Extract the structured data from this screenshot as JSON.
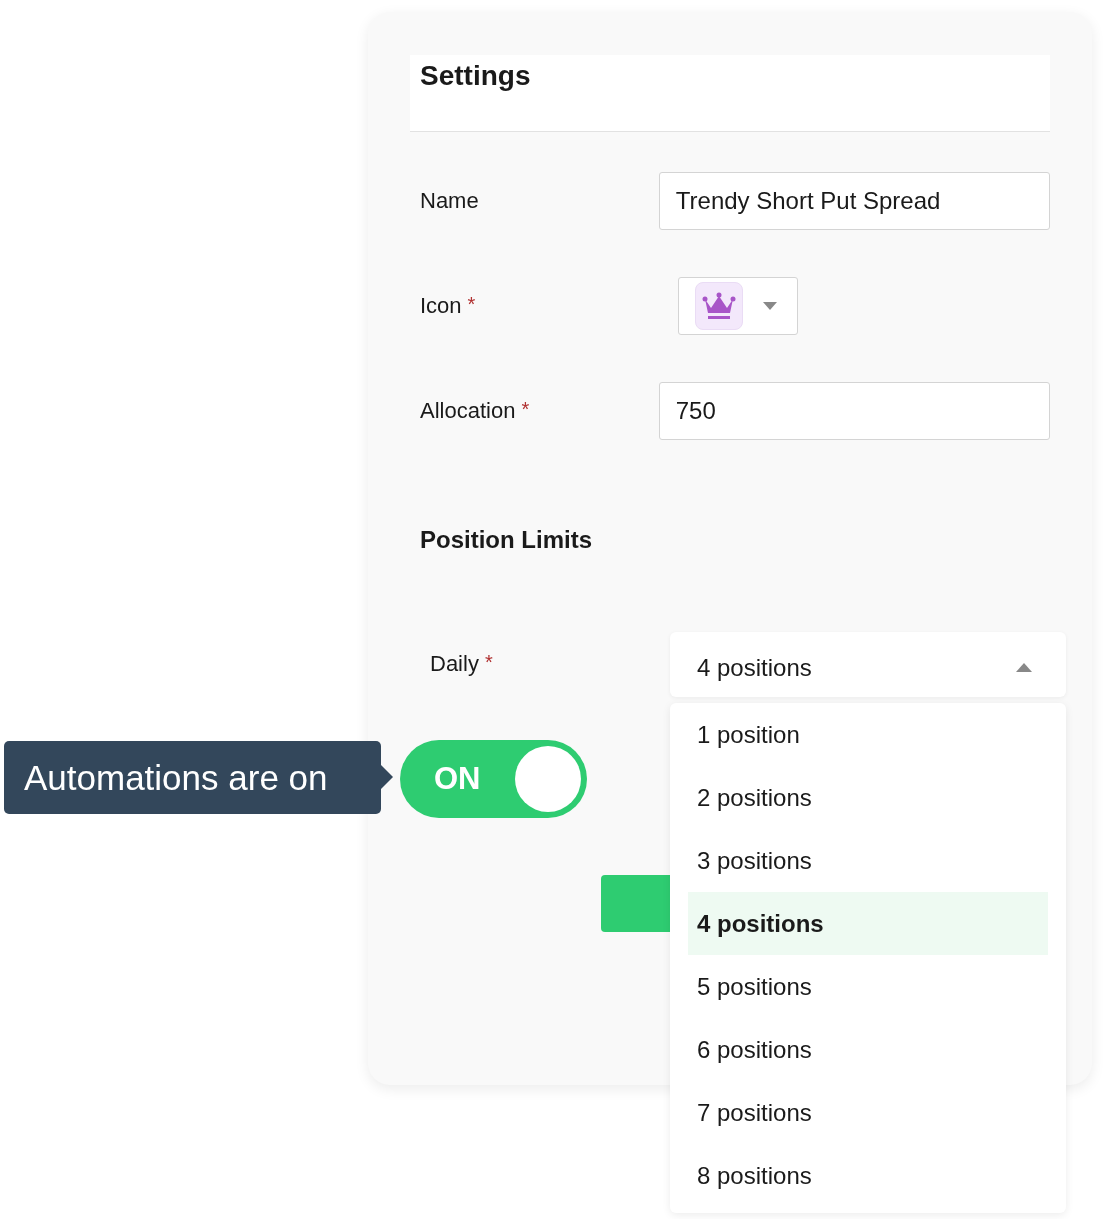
{
  "settings": {
    "title": "Settings",
    "fields": [
      {
        "kind": "text",
        "label": "Name",
        "value": "Trendy Short Put Spread"
      },
      {
        "kind": "icon",
        "label": "Icon",
        "mark": "*"
      },
      {
        "kind": "text",
        "label": "Allocation",
        "mark": "*",
        "value": "750"
      }
    ]
  },
  "position_limits": {
    "title": "Position Limits",
    "daily": {
      "label": "Daily",
      "mark": "*",
      "value": "4 positions",
      "expanded": true,
      "options": [
        {
          "label": "1 position",
          "selected": false
        },
        {
          "label": "2 positions",
          "selected": false
        },
        {
          "label": "3 positions",
          "selected": false
        },
        {
          "label": "4 positions",
          "selected": true
        },
        {
          "label": "5 positions",
          "selected": false
        },
        {
          "label": "6 positions",
          "selected": false
        },
        {
          "label": "7 positions",
          "selected": false
        },
        {
          "label": "8 positions",
          "selected": false
        }
      ]
    }
  },
  "automation": {
    "tooltip": "Automations are on",
    "toggle": {
      "label": "ON",
      "on": true
    }
  }
}
